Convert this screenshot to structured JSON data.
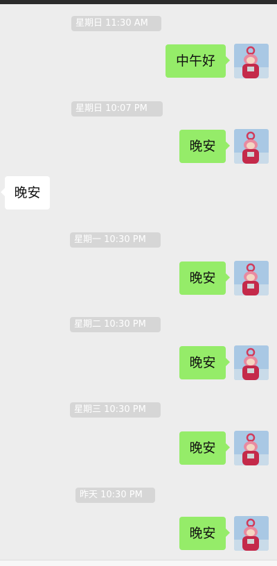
{
  "messages": [
    {
      "type": "timestamp",
      "text": "星期日 11:30 AM"
    },
    {
      "type": "sent",
      "text": "中午好"
    },
    {
      "type": "timestamp",
      "text": "星期日 10:07 PM"
    },
    {
      "type": "sent",
      "text": "晚安"
    },
    {
      "type": "received",
      "text": "晚安"
    },
    {
      "type": "timestamp",
      "text": "星期一 10:30 PM"
    },
    {
      "type": "sent",
      "text": "晚安"
    },
    {
      "type": "timestamp",
      "text": "星期二 10:30 PM"
    },
    {
      "type": "sent",
      "text": "晚安"
    },
    {
      "type": "timestamp",
      "text": "星期三 10:30 PM"
    },
    {
      "type": "sent",
      "text": "晚安"
    },
    {
      "type": "timestamp",
      "text": "昨天 10:30 PM"
    },
    {
      "type": "sent",
      "text": "晚安"
    }
  ],
  "colors": {
    "background": "#ededed",
    "sent_bubble": "#95ec69",
    "received_bubble": "#ffffff",
    "timestamp_bg": "#d6d6d6"
  },
  "icons": {
    "avatar": "teletubby-avatar-icon"
  }
}
